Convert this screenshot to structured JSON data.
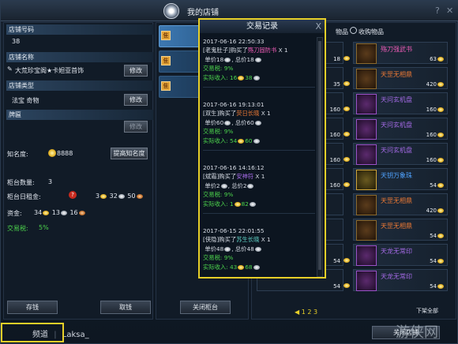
{
  "window": {
    "title": "我的店铺"
  },
  "shop_info": {
    "shop_number_label": "店铺号码",
    "shop_number": "38",
    "shop_name_label": "店铺名称",
    "shop_name": "大荒珍宝阁★卡妲亚首饰",
    "modify_label": "修改",
    "shop_type_label": "店铺类型",
    "shop_type": "法宝 奇物",
    "plaque_label": "牌匾",
    "reputation_label": "知名度:",
    "reputation_value": "8888",
    "improve_reputation_button": "提高知名度",
    "counter_count_label": "柜台数量:",
    "counter_count": "3",
    "daily_rent_label": "柜台日租金:",
    "daily_rent": {
      "gold": "3",
      "silver": "32",
      "copper": "50"
    },
    "funds_label": "资金:",
    "funds": {
      "gold": "34",
      "silver": "13",
      "copper": "16"
    },
    "tax_label": "交易税:",
    "tax_value": "5%",
    "deposit_button": "存钱",
    "withdraw_button": "取钱"
  },
  "counter": {
    "close_button": "关闭柜台"
  },
  "items_panel": {
    "header": "物品",
    "radio_label": "收购物品",
    "rows": [
      {
        "left_price": "18",
        "name": "殇刀强武书",
        "name_color": "#ee5bb6",
        "price": "63"
      },
      {
        "left_price": "35",
        "name": "天罡无相鼎",
        "name_color": "#ef7a34",
        "price": "420"
      },
      {
        "left_price": "160",
        "name": "天问玄机盘",
        "name_color": "#a56ae6",
        "price": "160"
      },
      {
        "left_price": "160",
        "name": "天问玄机盘",
        "name_color": "#a56ae6",
        "price": "160"
      },
      {
        "left_price": "160",
        "name": "天问玄机盘",
        "name_color": "#a56ae6",
        "price": "160"
      },
      {
        "left_price": "160",
        "name": "天钥万象珠",
        "name_color": "#4fa3ff",
        "price": "54"
      },
      {
        "left_price": "",
        "name": "天罡无相鼎",
        "name_color": "#ef7a34",
        "price": "420"
      },
      {
        "left_price": "",
        "name": "天罡无相鼎",
        "name_color": "#ef7a34",
        "price": "54"
      },
      {
        "left_price": "54",
        "name": "天龙无常印",
        "name_color": "#a56ae6",
        "price": "54"
      },
      {
        "left_price": "54",
        "name": "天龙无常印",
        "name_color": "#a56ae6",
        "price": "54"
      }
    ],
    "ghost_row": {
      "name": "天龙无常印",
      "price": "54"
    },
    "last_row": {
      "name": "天龙无常印",
      "price": "54"
    },
    "pagination": [
      "1",
      "2",
      "3"
    ],
    "next_page_label": "下架全部",
    "close_shop_button": "关闭店铺"
  },
  "transactions": {
    "title": "交易记录",
    "close": "X",
    "unit_label": "单价",
    "total_label": "总价",
    "tax_label": "交易税:",
    "income_label": "实际收入:",
    "entries": [
      {
        "time": "2017-06-16 22:50:33",
        "buyer": "[老鬼肚子]",
        "verb": "购买了",
        "item": "殇刀固防书",
        "qty": "X 1",
        "unit_price": "18",
        "total_price": "18",
        "tax": "9%",
        "income_gold": "16",
        "income_silver": "38"
      },
      {
        "time": "2017-06-16 19:13:01",
        "buyer": "[双生]",
        "verb": "购买了",
        "item": "荧日长晓",
        "qty": "X 1",
        "unit_price": "60",
        "total_price": "60",
        "tax": "9%",
        "income_gold": "54",
        "income_silver": "60"
      },
      {
        "time": "2017-06-16 14:16:12",
        "buyer": "[斌霜]",
        "verb": "购买了",
        "item": "安神符",
        "qty": "X 1",
        "unit_price": "2",
        "total_price": "2",
        "tax": "9%",
        "income_gold": "1",
        "income_silver": "82"
      },
      {
        "time": "2017-06-15 22:01:55",
        "buyer": "[侠隐]",
        "verb": "购买了",
        "item": "苏生长晓",
        "qty": "X 1",
        "unit_price": "48",
        "total_price": "48",
        "tax": "9%",
        "income_gold": "43",
        "income_silver": "68"
      }
    ]
  },
  "footer": {
    "player_name": "Laksa_",
    "channel_label": "频道"
  },
  "watermark": "游侠网",
  "colors": {
    "accent": "#e7cf28",
    "tax_green": "#4cd44c",
    "panel_bg": "#111b27"
  }
}
